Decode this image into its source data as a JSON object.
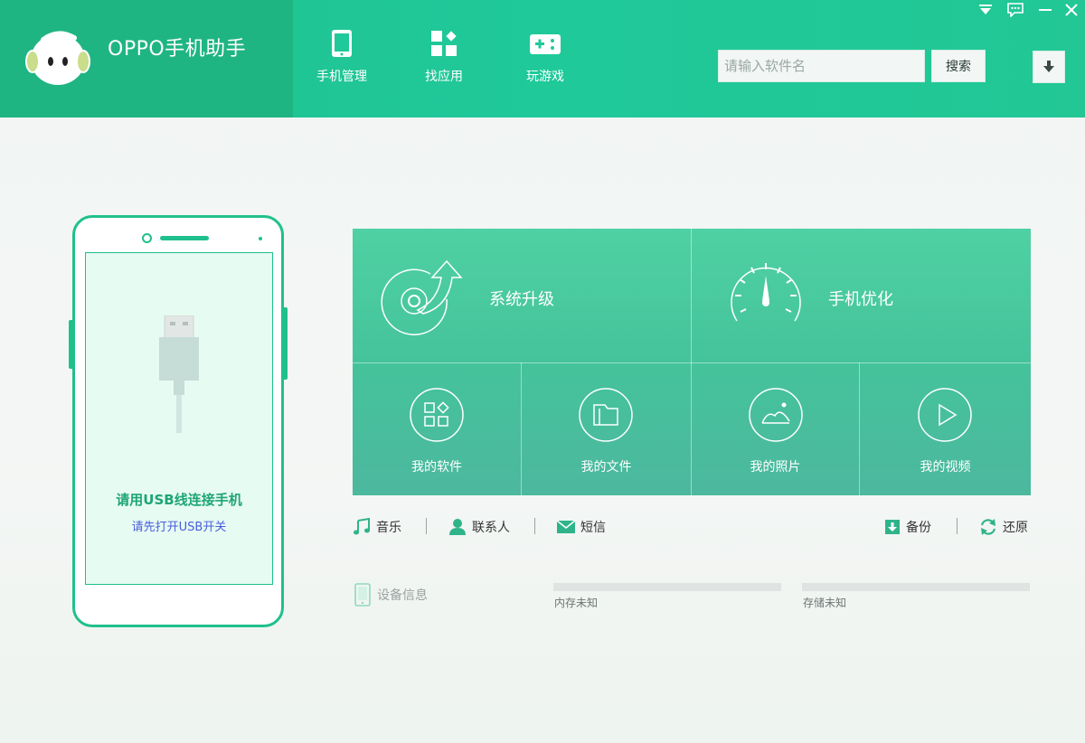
{
  "app": {
    "title": "OPPO手机助手"
  },
  "nav": [
    {
      "label": "手机管理",
      "icon": "phone-manage-icon"
    },
    {
      "label": "找应用",
      "icon": "apps-icon"
    },
    {
      "label": "玩游戏",
      "icon": "gamepad-icon"
    }
  ],
  "search": {
    "placeholder": "请输入软件名",
    "value": "",
    "button_label": "搜索"
  },
  "window_controls": [
    "menu-icon",
    "feedback-icon",
    "minimize-icon",
    "close-icon"
  ],
  "phone": {
    "connect_title": "请用USB线连接手机",
    "connect_hint": "请先打开USB开关"
  },
  "tiles": {
    "system_upgrade": "系统升级",
    "phone_optimize": "手机优化",
    "my_apps": "我的软件",
    "my_files": "我的文件",
    "my_photos": "我的照片",
    "my_videos": "我的视频"
  },
  "quick_links": {
    "music": "音乐",
    "contacts": "联系人",
    "sms": "短信",
    "backup": "备份",
    "restore": "还原"
  },
  "device": {
    "label": "设备信息",
    "memory": "内存未知",
    "storage": "存储未知"
  },
  "colors": {
    "header": "#1fc99a",
    "accent": "#20c08c",
    "tile": "#4cc69e",
    "link_blue": "#4a5ddc"
  }
}
